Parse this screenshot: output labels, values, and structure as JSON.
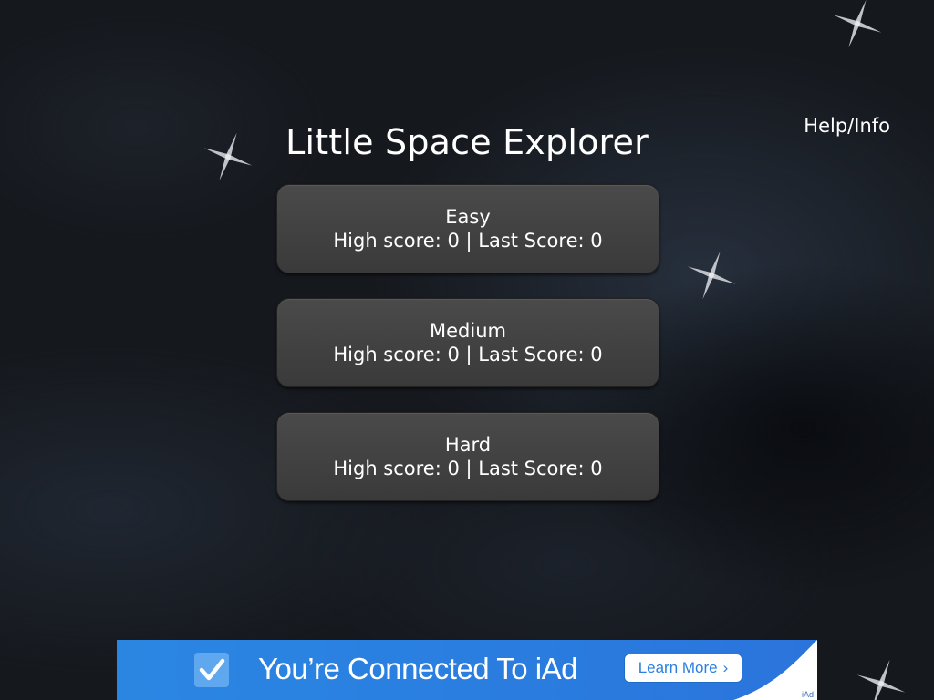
{
  "game": {
    "title": "Little Space Explorer",
    "help_label": "Help/Info"
  },
  "modes": [
    {
      "name": "Easy",
      "scores": "High score: 0 | Last Score: 0"
    },
    {
      "name": "Medium",
      "scores": "High score: 0 | Last Score: 0"
    },
    {
      "name": "Hard",
      "scores": "High score: 0 | Last Score: 0"
    }
  ],
  "ad": {
    "headline": "You’re Connected To iAd",
    "button_label": "Learn More",
    "tag": "iAd"
  },
  "colors": {
    "background": "#15181d",
    "button": "#404040",
    "ad_blue": "#2a7fe0",
    "star": "#c8c8c8"
  },
  "icons": {
    "star": "sparkle-star-icon",
    "ad_check": "checkbox-check-icon",
    "learn_more_chevron": "chevron-right-icon"
  }
}
